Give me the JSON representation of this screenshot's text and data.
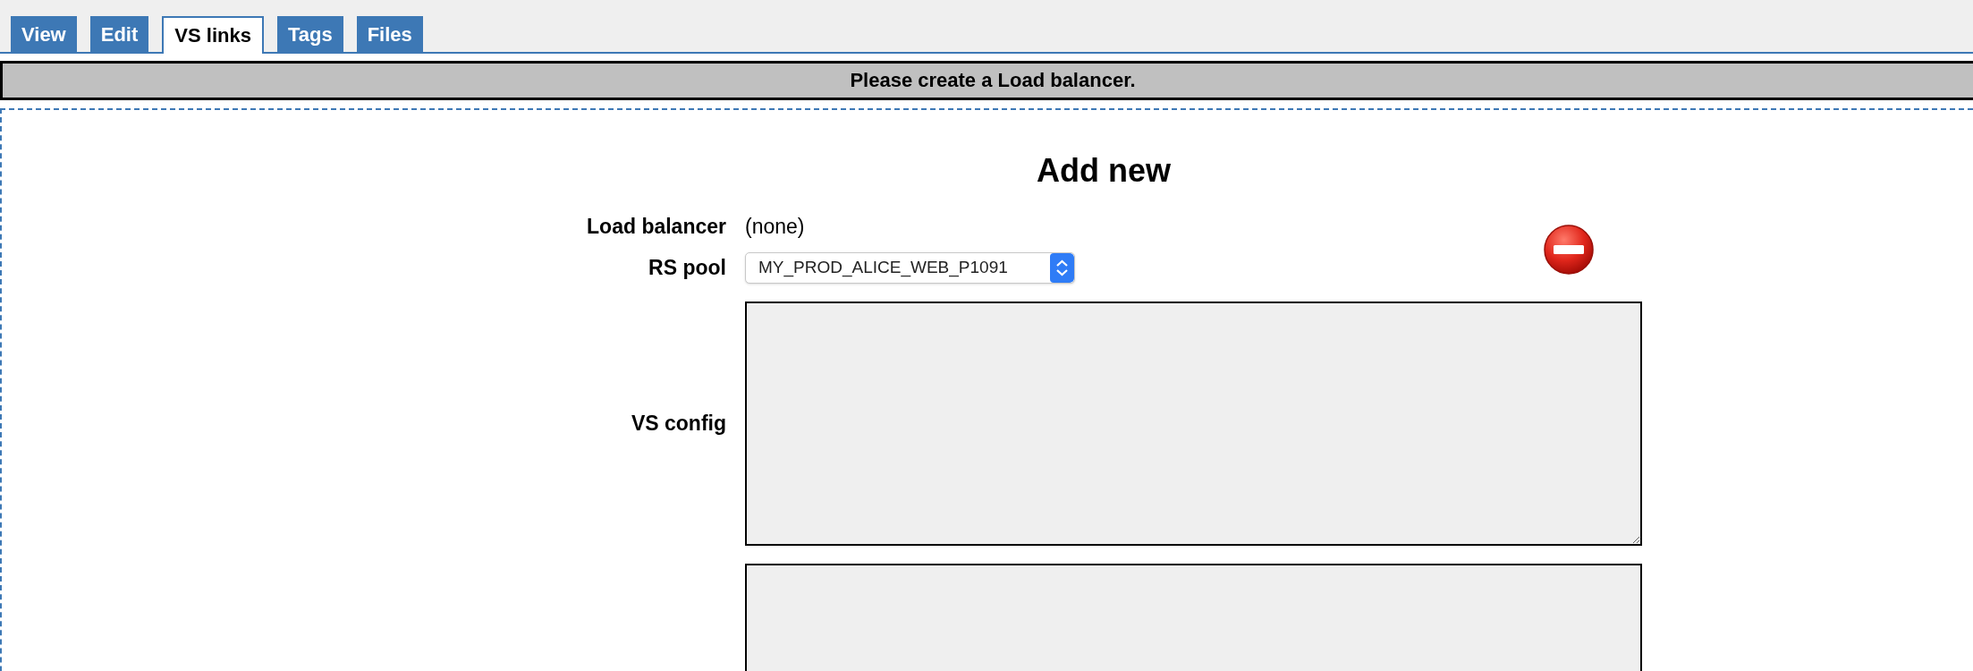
{
  "tabs": [
    {
      "label": "View",
      "selected": false
    },
    {
      "label": "Edit",
      "selected": false
    },
    {
      "label": "VS links",
      "selected": true
    },
    {
      "label": "Tags",
      "selected": false
    },
    {
      "label": "Files",
      "selected": false
    }
  ],
  "message": "Please create a Load balancer.",
  "form": {
    "title": "Add new",
    "fields": [
      {
        "kind": "text",
        "label": "Load balancer",
        "value": "(none)"
      },
      {
        "kind": "select",
        "label": "RS pool",
        "value": "MY_PROD_ALICE_WEB_P1091"
      },
      {
        "kind": "textarea",
        "label": "VS config"
      },
      {
        "kind": "textarea"
      }
    ]
  }
}
